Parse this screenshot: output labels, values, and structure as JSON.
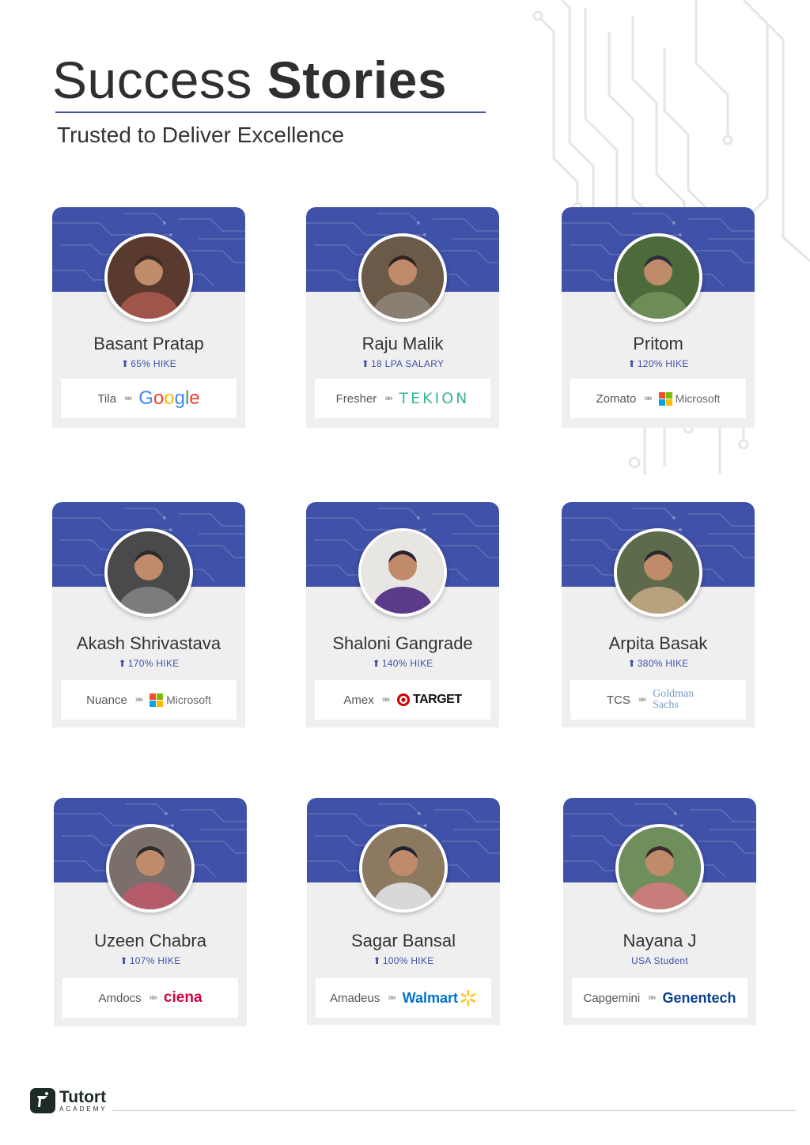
{
  "header": {
    "title_light": "Success",
    "title_bold": "Stories",
    "subtitle": "Trusted to Deliver Excellence"
  },
  "colors": {
    "brand_blue": "#3f51a8",
    "card_bg": "#efeff0"
  },
  "cards": [
    {
      "name": "Basant Pratap",
      "hike": "65% HIKE",
      "from": "Tila",
      "to": "Google",
      "to_logo": "google-logo"
    },
    {
      "name": "Raju Malik",
      "hike": "18 LPA SALARY",
      "from": "Fresher",
      "to": "TEKION",
      "to_logo": "tekion-logo"
    },
    {
      "name": "Pritom",
      "hike": "120% HIKE",
      "from": "Zomato",
      "to": "Microsoft",
      "to_logo": "microsoft-logo"
    },
    {
      "name": "Akash Shrivastava",
      "hike": "170% HIKE",
      "from": "Nuance",
      "to": "Microsoft",
      "to_logo": "microsoft-logo"
    },
    {
      "name": "Shaloni Gangrade",
      "hike": "140% HIKE",
      "from": "Amex",
      "to": "TARGET",
      "to_logo": "target-logo"
    },
    {
      "name": "Arpita Basak",
      "hike": "380% HIKE",
      "from": "TCS",
      "to": "Goldman Sachs",
      "to_logo": "goldman-sachs-logo"
    },
    {
      "name": "Uzeen Chabra",
      "hike": "107% HIKE",
      "from": "Amdocs",
      "to": "ciena",
      "to_logo": "ciena-logo"
    },
    {
      "name": "Sagar Bansal",
      "hike": "100% HIKE",
      "from": "Amadeus",
      "to": "Walmart",
      "to_logo": "walmart-logo"
    },
    {
      "name": "Nayana J",
      "hike": "USA Student",
      "from": "Capgemini",
      "to": "Genentech",
      "to_logo": "genentech-logo"
    }
  ],
  "footer": {
    "brand": "Tutort",
    "sub": "ACADEMY"
  }
}
